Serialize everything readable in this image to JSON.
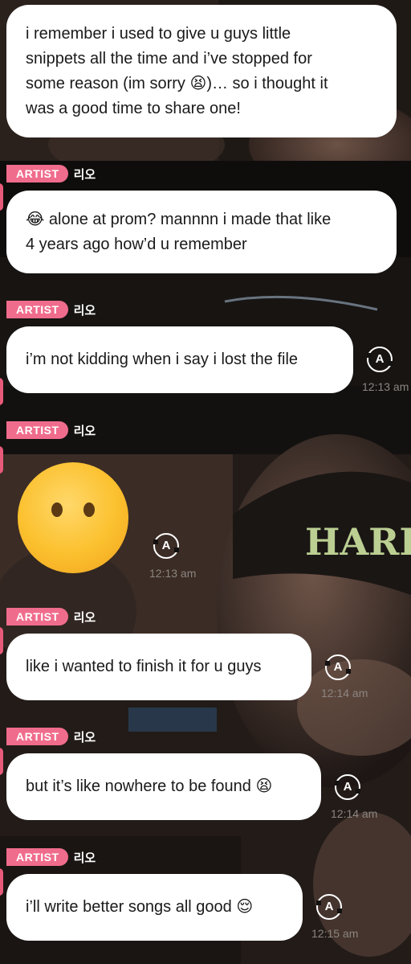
{
  "sender_badge": "ARTIST",
  "sender_name": "리오",
  "translate_icon_glyph": "A",
  "colors": {
    "badge": "#f06c8c",
    "bubble": "#ffffff",
    "time": "#8b8581"
  },
  "messages": [
    {
      "lines": [
        "i remember i used to give u guys little",
        "snippets all the time and i’ve stopped for",
        "some reason (im sorry 😫)… so i thought it",
        "was a good time to share one!"
      ]
    },
    {
      "lines": [
        "😂 alone at prom? mannnn i made that like",
        "4 years ago how’d u remember"
      ]
    },
    {
      "text": "i’m not kidding when i say i lost the file",
      "time": "12:13 am"
    },
    {
      "type": "emoji",
      "emoji": "😶",
      "time": "12:13 am"
    },
    {
      "text": "like i wanted to finish it for u guys",
      "time": "12:14 am"
    },
    {
      "text": "but it’s like nowhere to be found 😫",
      "time": "12:14 am"
    },
    {
      "text": "i’ll write better songs all good 😌",
      "time": "12:15 am"
    }
  ]
}
